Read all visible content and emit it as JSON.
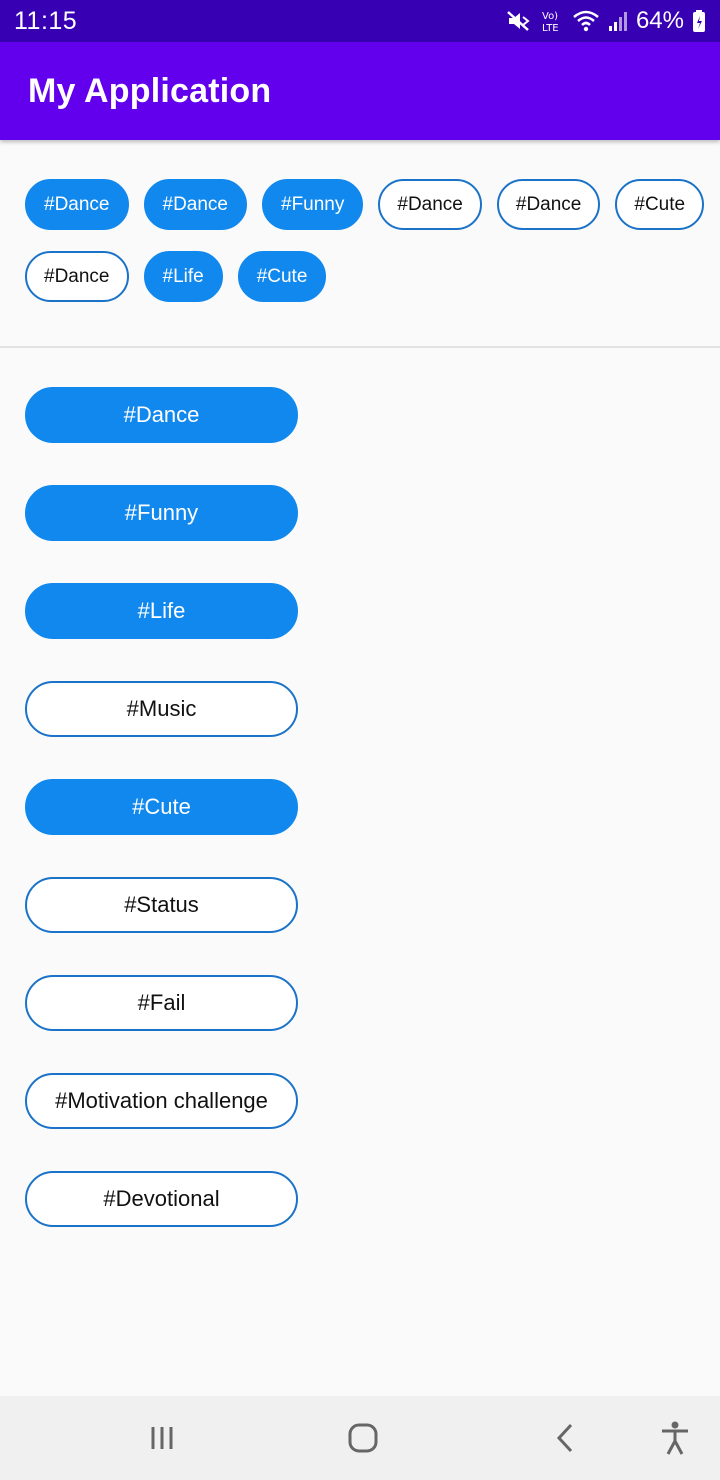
{
  "status_bar": {
    "time": "11:15",
    "battery": "64%",
    "icons": [
      "mute-icon",
      "volte-icon",
      "wifi-icon",
      "signal-icon",
      "battery-icon"
    ]
  },
  "app_bar": {
    "title": "My Application"
  },
  "chips": [
    {
      "label": "#Dance",
      "selected": true
    },
    {
      "label": "#Dance",
      "selected": true
    },
    {
      "label": "#Funny",
      "selected": true
    },
    {
      "label": "#Dance",
      "selected": false
    },
    {
      "label": "#Dance",
      "selected": false
    },
    {
      "label": "#Cute",
      "selected": false
    },
    {
      "label": "#Dance",
      "selected": false
    },
    {
      "label": "#Life",
      "selected": true
    },
    {
      "label": "#Cute",
      "selected": true
    }
  ],
  "tag_list": [
    {
      "label": "#Dance",
      "selected": true
    },
    {
      "label": "#Funny",
      "selected": true
    },
    {
      "label": "#Life",
      "selected": true
    },
    {
      "label": "#Music",
      "selected": false
    },
    {
      "label": "#Cute",
      "selected": true
    },
    {
      "label": "#Status",
      "selected": false
    },
    {
      "label": "#Fail",
      "selected": false
    },
    {
      "label": "#Motivation challenge",
      "selected": false
    },
    {
      "label": "#Devotional",
      "selected": false
    }
  ],
  "nav_bar": {
    "icons": [
      "recent-apps-icon",
      "home-icon",
      "back-icon",
      "accessibility-icon"
    ]
  },
  "colors": {
    "status_bar": "#3700b3",
    "app_bar": "#6200ee",
    "chip_selected": "#1188ee",
    "chip_outline": "#1a73c8"
  }
}
